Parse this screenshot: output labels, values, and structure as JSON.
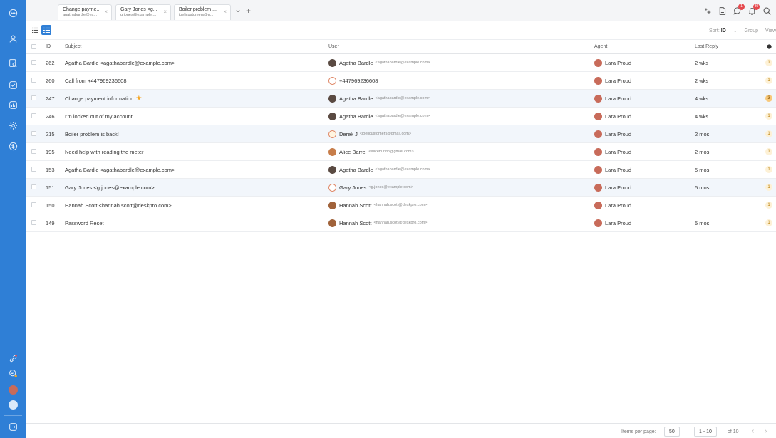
{
  "tabs": [
    {
      "title": "Change payme...",
      "subtitle": "agathabardle@ex...",
      "close": "×"
    },
    {
      "title": "Gary Jones <g...",
      "subtitle": "g.jones@example....",
      "close": "×"
    },
    {
      "title": "Boiler problem ...",
      "subtitle": "joelicustomers@g...",
      "close": "×"
    }
  ],
  "tab_controls": {
    "more": "⌄",
    "add": "+"
  },
  "top_icons": {
    "notif_badge_1": "1",
    "notif_badge_2": "30"
  },
  "toolbar": {
    "sort_label": "Sort:",
    "sort_value": "ID",
    "sort_dir": "⇣",
    "group_label": "Group",
    "view_label": "View"
  },
  "columns": {
    "id": "ID",
    "subject": "Subject",
    "user": "User",
    "agent": "Agent",
    "last_reply": "Last Reply"
  },
  "rows": [
    {
      "id": "262",
      "subject": "Agatha Bardle <agathabardle@example.com>",
      "user": "Agatha Bardle",
      "email": "<agathabardle@example.com>",
      "agent": "Lara Proud",
      "last_reply": "2 wks",
      "count": "1"
    },
    {
      "id": "260",
      "subject": "Call from +447969236608",
      "user": "+447969236608",
      "email": "",
      "agent": "Lara Proud",
      "last_reply": "2 wks",
      "count": "1"
    },
    {
      "id": "247",
      "subject": "Change payment information",
      "user": "Agatha Bardle",
      "email": "<agathabardle@example.com>",
      "agent": "Lara Proud",
      "last_reply": "4 wks",
      "count": "3"
    },
    {
      "id": "246",
      "subject": "I'm locked out of my account",
      "user": "Agatha Bardle",
      "email": "<agathabardle@example.com>",
      "agent": "Lara Proud",
      "last_reply": "4 wks",
      "count": "1"
    },
    {
      "id": "215",
      "subject": "Boiler problem is back!",
      "user": "Derek J",
      "email": "<joelicustomers@gmail.com>",
      "agent": "Lara Proud",
      "last_reply": "2 mos",
      "count": "1"
    },
    {
      "id": "195",
      "subject": "Need help with reading the meter",
      "user": "Alice Barrel",
      "email": "<aliceburvin@gmail.com>",
      "agent": "Lara Proud",
      "last_reply": "2 mos",
      "count": "1"
    },
    {
      "id": "153",
      "subject": "Agatha Bardle <agathabardle@example.com>",
      "user": "Agatha Bardle",
      "email": "<agathabardle@example.com>",
      "agent": "Lara Proud",
      "last_reply": "5 mos",
      "count": "1"
    },
    {
      "id": "151",
      "subject": "Gary Jones <g.jones@example.com>",
      "user": "Gary Jones",
      "email": "<g.jones@example.com>",
      "agent": "Lara Proud",
      "last_reply": "5 mos",
      "count": "1"
    },
    {
      "id": "150",
      "subject": "Hannah Scott <hannah.scott@deskpro.com>",
      "user": "Hannah Scott",
      "email": "<hannah.scott@deskpro.com>",
      "agent": "Lara Proud",
      "last_reply": "",
      "count": "1"
    },
    {
      "id": "149",
      "subject": "Password Reset",
      "user": "Hannah Scott",
      "email": "<hannah.scott@deskpro.com>",
      "agent": "Lara Proud",
      "last_reply": "5 mos",
      "count": "1"
    }
  ],
  "footer": {
    "items_per_page_label": "Items per page:",
    "items_per_page": "50",
    "range": "1 - 10",
    "of_total": "of 10",
    "prev": "‹",
    "next": "›"
  },
  "colors": {
    "rail": "#2f7fd6",
    "accent": "#2f7fd6",
    "row_highlight": "#f2f6fb",
    "badge": "#e5484d"
  }
}
